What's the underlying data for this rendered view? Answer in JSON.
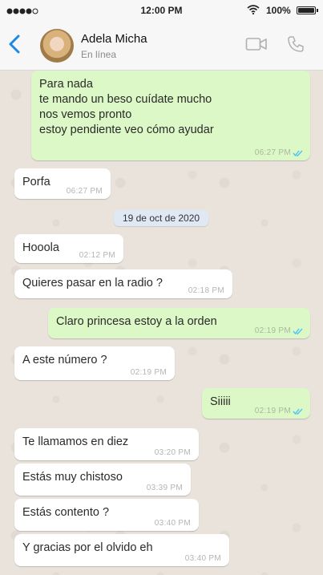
{
  "status_bar": {
    "time": "12:00 PM",
    "battery": "100%"
  },
  "header": {
    "contact_name": "Adela Micha",
    "contact_status": "En línea"
  },
  "messages": [
    {
      "dir": "out",
      "text": "Para nada\nte mando un beso cuídate mucho\nnos vemos pronto\nestoy pendiente veo cómo ayudar",
      "time": "06:27 PM",
      "read": true
    },
    {
      "dir": "in",
      "text": "Porfa",
      "time": "06:27 PM"
    },
    {
      "dir": "in",
      "text": "Hooola",
      "time": "02:12 PM"
    },
    {
      "dir": "in",
      "text": "Quieres pasar en la radio ?",
      "time": "02:18 PM"
    },
    {
      "dir": "out",
      "text": "Claro princesa estoy a la orden",
      "time": "02:19 PM",
      "read": true
    },
    {
      "dir": "in",
      "text": "A este número ?",
      "time": "02:19 PM"
    },
    {
      "dir": "out",
      "text": "Siiiii",
      "time": "02:19 PM",
      "read": true
    },
    {
      "dir": "in",
      "text": "Te llamamos en diez",
      "time": "03:20 PM"
    },
    {
      "dir": "in",
      "text": "Estás muy chistoso",
      "time": "03:39 PM"
    },
    {
      "dir": "in",
      "text": "Estás contento ?",
      "time": "03:40 PM"
    },
    {
      "dir": "in",
      "text": "Y gracias por el olvido eh",
      "time": "03:40 PM"
    }
  ],
  "date_separator": "19 de oct de 2020",
  "colors": {
    "accent": "#1e88e5",
    "outgoing_bubble": "#dcf8c6",
    "incoming_bubble": "#ffffff",
    "read_ticks": "#4fc3f7",
    "chat_background": "#e9e3dc"
  },
  "icons": [
    "back-chevron-icon",
    "video-call-icon",
    "phone-call-icon",
    "wifi-icon",
    "battery-icon",
    "signal-icon",
    "double-check-icon"
  ]
}
